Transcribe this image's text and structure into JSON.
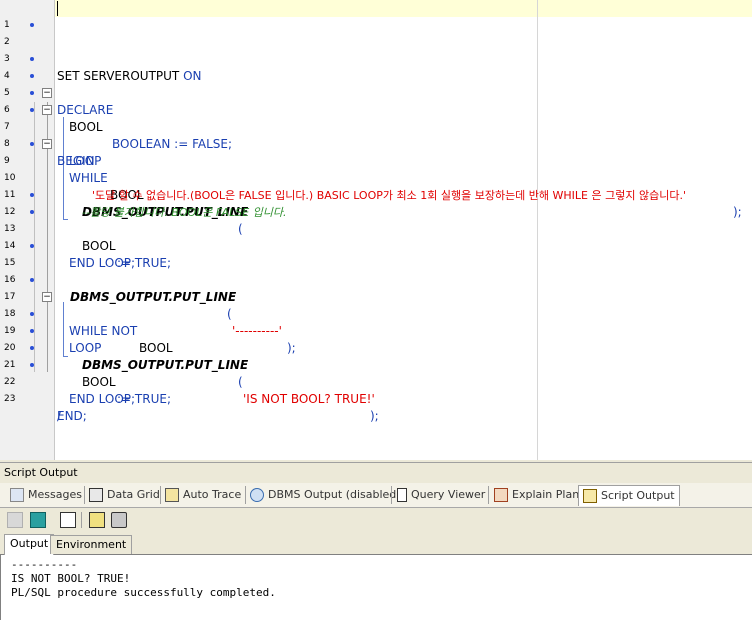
{
  "editor": {
    "line_numbers": [
      "1",
      "2",
      "3",
      "4",
      "5",
      "6",
      "7",
      "8",
      "9",
      "10",
      "11",
      "12",
      "13",
      "14",
      "15",
      "16",
      "17",
      "18",
      "19",
      "20",
      "21",
      "22",
      "23"
    ],
    "l2": "SET SERVEROUTPUT ON",
    "l4": "DECLARE",
    "l5_var": "BOOL",
    "l5_type": "BOOLEAN := FALSE;",
    "l6": "BEGIN",
    "l7_kw": "WHILE",
    "l7_var": "BOOL",
    "l8": "LOOP",
    "l9_fn": "DBMS_OUTPUT.PUT_LINE",
    "l9_paren": "(",
    "l10_str": "'도달 할 수 없습니다.(BOOL은 FALSE 입니다.) BASIC LOOP가 최소 1회 실행을 보장하는데 반해 WHILE 은 그렇지 않습니다.'",
    "l10_end": ");",
    "l11_comment": "--활당 불가합니다. BOOL은 FALSE 입니다.",
    "l12_var": "BOOL",
    "l12_rest": ":= TRUE;",
    "l13": "END LOOP;",
    "l15_fn": "DBMS_OUTPUT.PUT_LINE",
    "l15_open": "(",
    "l15_str": "'----------'",
    "l15_end": ");",
    "l17_kw": "WHILE NOT",
    "l17_var": "BOOL",
    "l18": "LOOP",
    "l19_fn": "DBMS_OUTPUT.PUT_LINE",
    "l19_open": "(",
    "l19_str": "'IS NOT BOOL? TRUE!'",
    "l19_end": ");",
    "l20_var": "BOOL",
    "l20_rest": ":= TRUE;",
    "l21": "END LOOP;",
    "l22": "END;",
    "l23": "/"
  },
  "panel": {
    "title": "Script Output",
    "tabs": [
      {
        "label": "Messages",
        "icon": "messages-icon"
      },
      {
        "label": "Data Grid",
        "icon": "grid-icon"
      },
      {
        "label": "Auto Trace",
        "icon": "autotrace-icon"
      },
      {
        "label": "DBMS Output (disabled)",
        "icon": "dbms-output-icon"
      },
      {
        "label": "Query Viewer",
        "icon": "query-viewer-icon"
      },
      {
        "label": "Explain Plan",
        "icon": "explain-plan-icon"
      },
      {
        "label": "Script Output",
        "icon": "script-output-icon"
      }
    ],
    "subtabs": [
      "Output",
      "Environment"
    ],
    "output_lines": [
      "----------",
      "IS NOT BOOL? TRUE!",
      "PL/SQL procedure successfully completed."
    ]
  },
  "colors": {
    "keyword": "#1a3fb0",
    "string": "#e00000",
    "comment": "#2f8f2f",
    "current_line": "#ffffd7"
  }
}
